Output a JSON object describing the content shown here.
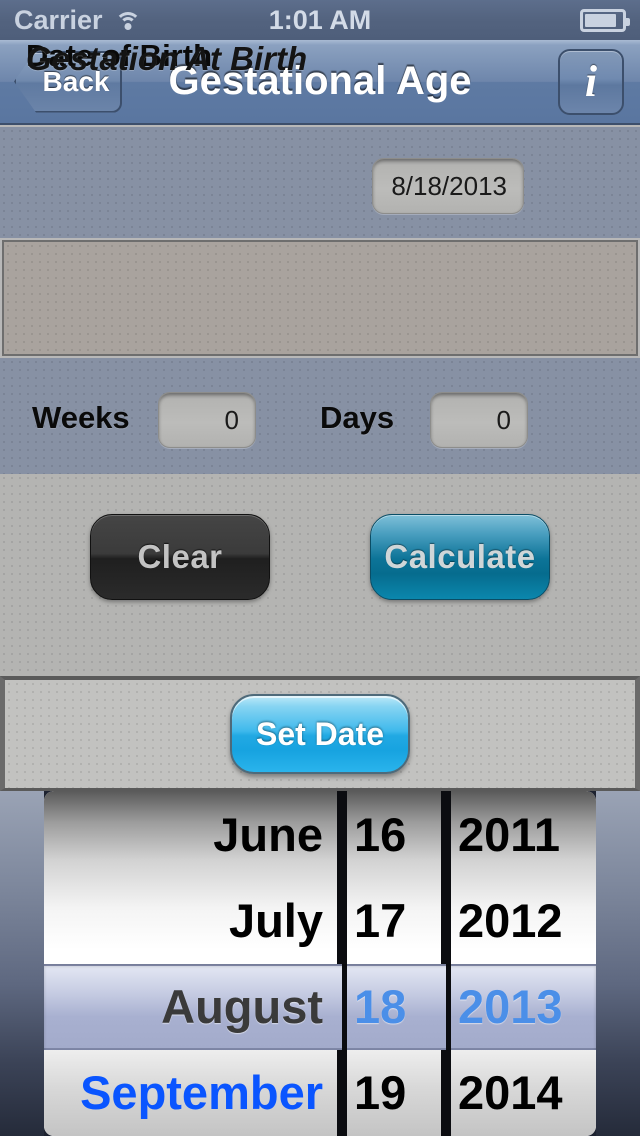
{
  "status_bar": {
    "carrier": "Carrier",
    "wifi_icon": "wifi-icon",
    "time": "1:01 AM",
    "battery_icon": "battery-icon",
    "battery_level_pct": 85
  },
  "nav_bar": {
    "back_label": "Back",
    "title": "Gestational Age",
    "info_label": "i",
    "info_icon": "info-icon"
  },
  "form": {
    "dob_label": "Date of Birth",
    "dob_value": "8/18/2013",
    "gestation_header": "Gestation At Birth",
    "weeks_label": "Weeks",
    "weeks_value": "0",
    "days_label": "Days",
    "days_value": "0"
  },
  "actions": {
    "clear_label": "Clear",
    "calculate_label": "Calculate",
    "set_date_label": "Set Date"
  },
  "date_picker": {
    "selected_month": "August",
    "selected_day": "18",
    "selected_year": "2013",
    "months": [
      "June",
      "July",
      "August",
      "September"
    ],
    "days": [
      "16",
      "17",
      "18",
      "19"
    ],
    "years": [
      "2011",
      "2012",
      "2013",
      "2014"
    ]
  },
  "colors": {
    "nav_bar": "#6e86ab",
    "status_bar": "#53637f",
    "panel_blue_gray": "#8791a4",
    "panel_beige": "#a9a39e",
    "panel_light_gray": "#b4b4b2",
    "calculate_teal": "#0d7498",
    "set_date_blue": "#22a9e3",
    "picker_selected_blue": "#4b8fe8",
    "picker_link_blue": "#0a55ff"
  }
}
